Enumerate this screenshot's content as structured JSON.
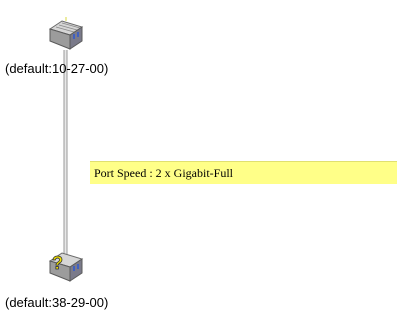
{
  "topology": {
    "devices": [
      {
        "label": "(default:10-27-00)",
        "icon": "switch-icon"
      },
      {
        "label": "(default:38-29-00)",
        "icon": "switch-warning-icon"
      }
    ],
    "link": {
      "tooltip": "Port Speed : 2 x Gigabit-Full"
    }
  },
  "colors": {
    "tooltip_bg": "#ffff88",
    "link_line": "#a0a0a0",
    "warning": "#f0e000"
  }
}
